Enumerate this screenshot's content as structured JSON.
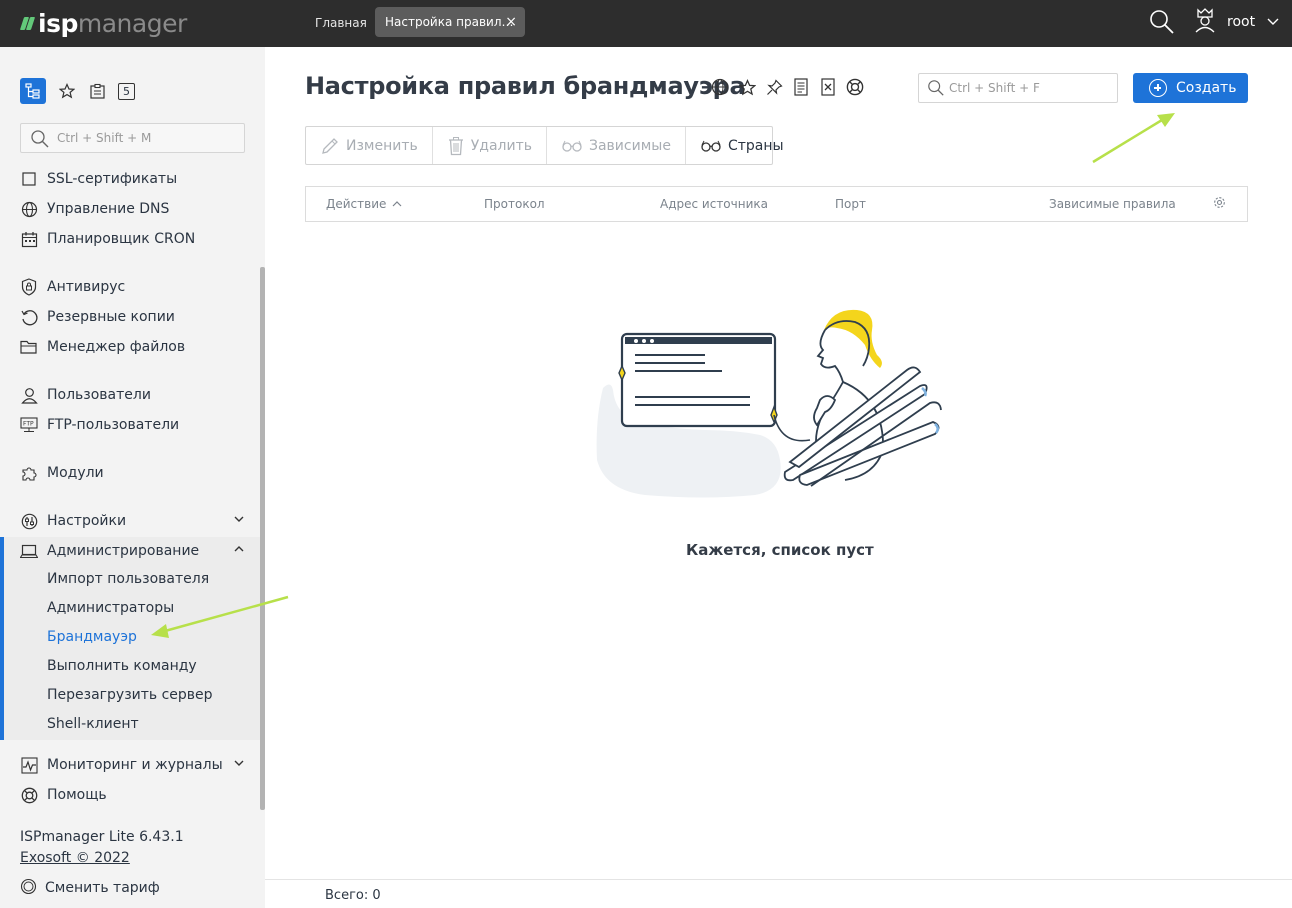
{
  "app": {
    "logo_isp": "isp",
    "logo_manager": "manager",
    "accent": "#1e73d8",
    "logo_mark_color": "#63c97a"
  },
  "topbar": {
    "tabs": [
      {
        "label": "Главная"
      },
      {
        "label": "Настройка правил брандмауэра",
        "short": "Настройка правил…",
        "close": "×"
      }
    ],
    "user_name": "root"
  },
  "sidebar": {
    "search_placeholder": "Ctrl + Shift + M",
    "counter_badge": "5",
    "items": [
      {
        "label": "SSL-сертификаты",
        "icon": "certificate-icon"
      },
      {
        "label": "Управление DNS",
        "icon": "globe-icon"
      },
      {
        "label": "Планировщик CRON",
        "icon": "calendar-icon"
      },
      {
        "label": "Антивирус",
        "icon": "shield-icon"
      },
      {
        "label": "Резервные копии",
        "icon": "backup-icon"
      },
      {
        "label": "Менеджер файлов",
        "icon": "folder-icon"
      },
      {
        "label": "Пользователи",
        "icon": "user-icon"
      },
      {
        "label": "FTP-пользователи",
        "icon": "ftp-icon"
      },
      {
        "label": "Модули",
        "icon": "puzzle-icon"
      },
      {
        "label": "Настройки",
        "icon": "settings-icon"
      },
      {
        "label": "Администрирование",
        "icon": "laptop-icon"
      },
      {
        "label": "Мониторинг и журналы",
        "icon": "monitoring-icon"
      },
      {
        "label": "Помощь",
        "icon": "lifebuoy-icon"
      }
    ],
    "admin_subitems": [
      {
        "label": "Импорт пользователя"
      },
      {
        "label": "Администраторы"
      },
      {
        "label": "Брандмауэр",
        "active": true
      },
      {
        "label": "Выполнить команду"
      },
      {
        "label": "Перезагрузить сервер"
      },
      {
        "label": "Shell-клиент"
      }
    ],
    "footer": {
      "version": "ISPmanager Lite 6.43.1",
      "copyright": "Exosoft © 2022",
      "change_plan": "Сменить тариф"
    }
  },
  "main": {
    "title": "Настройка правил брандмауэра",
    "search_placeholder": "Ctrl + Shift + F",
    "create_label": "Создать",
    "toolbar": [
      {
        "label": "Изменить",
        "enabled": false,
        "icon": "pencil-icon"
      },
      {
        "label": "Удалить",
        "enabled": false,
        "icon": "trash-icon"
      },
      {
        "label": "Зависимые",
        "enabled": false,
        "icon": "glasses-icon"
      },
      {
        "label": "Страны",
        "enabled": true,
        "icon": "glasses-icon"
      }
    ],
    "columns": [
      "Действие",
      "Протокол",
      "Адрес источника",
      "Порт",
      "Зависимые правила"
    ],
    "sort_arrow": "^",
    "empty_text": "Кажется, список пуст",
    "total_label": "Всего: 0"
  }
}
